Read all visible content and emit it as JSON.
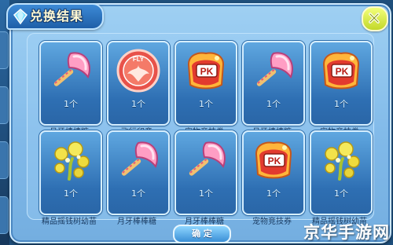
{
  "dialog": {
    "title": "兑换结果",
    "confirm_label": "确 定"
  },
  "items": [
    {
      "name": "月牙棒棒糖",
      "qty": "1个",
      "icon": "moon-lollipop-icon"
    },
    {
      "name": "飞行印章",
      "qty": "1个",
      "icon": "flight-seal-icon"
    },
    {
      "name": "宠物竞技券",
      "qty": "1个",
      "icon": "pet-pk-ticket-icon"
    },
    {
      "name": "月牙棒棒糖",
      "qty": "1个",
      "icon": "moon-lollipop-icon"
    },
    {
      "name": "宠物竞技券",
      "qty": "1个",
      "icon": "pet-pk-ticket-icon"
    },
    {
      "name": "精品摇钱树幼苗",
      "qty": "1个",
      "icon": "money-tree-seedling-icon"
    },
    {
      "name": "月牙棒棒糖",
      "qty": "1个",
      "icon": "moon-lollipop-icon"
    },
    {
      "name": "月牙棒棒糖",
      "qty": "1个",
      "icon": "moon-lollipop-icon"
    },
    {
      "name": "宠物竞技券",
      "qty": "1个",
      "icon": "pet-pk-ticket-icon"
    },
    {
      "name": "精品摇钱树幼苗",
      "qty": "1个",
      "icon": "money-tree-seedling-icon"
    }
  ],
  "seal_text": "FLY",
  "ticket_text": "PK",
  "watermark": "京华手游网"
}
